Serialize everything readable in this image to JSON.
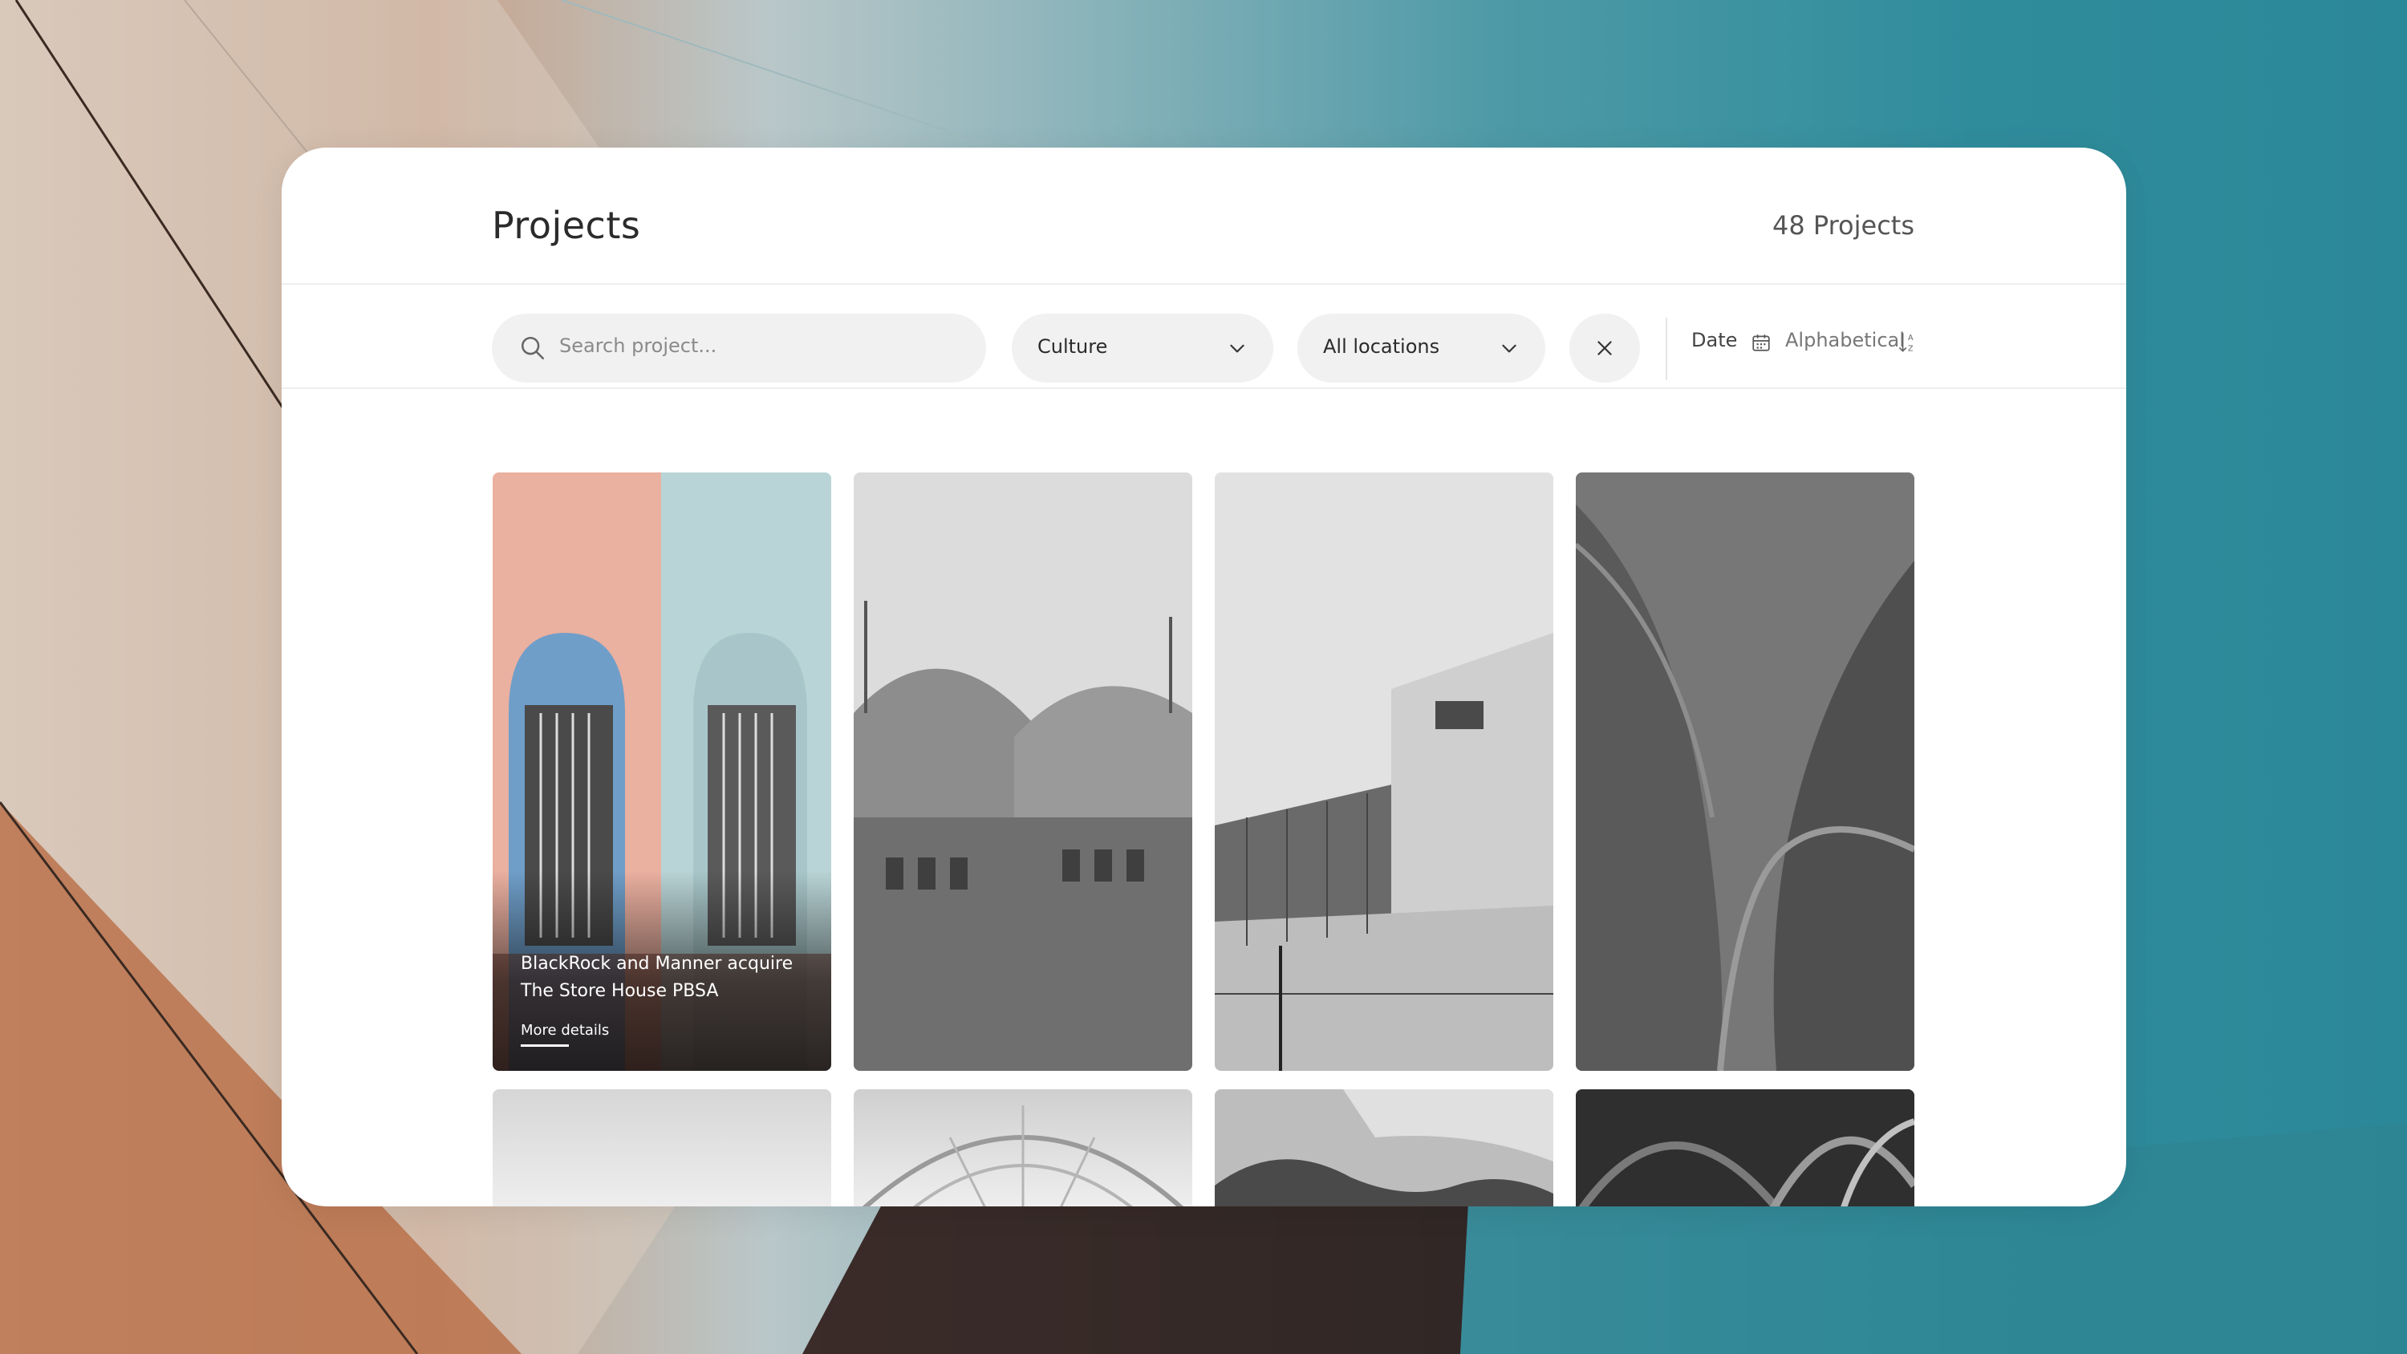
{
  "header": {
    "title": "Projects",
    "count": "48 Projects"
  },
  "filters": {
    "search_placeholder": "Search project...",
    "category": "Culture",
    "location": "All locations",
    "sort_date_label": "Date",
    "sort_alpha_label": "Alphabetical"
  },
  "projects": [
    {
      "title": "BlackRock and Manner acquire The Store House PBSA",
      "link": "More details"
    }
  ],
  "icons": {
    "search": "search-icon",
    "chevron": "chevron-down-icon",
    "clear": "close-icon",
    "calendar": "calendar-icon",
    "sort": "sort-az-icon"
  },
  "colors": {
    "card_bg": "#ffffff",
    "control_bg": "#f1f1f1",
    "text_primary": "#2b2b2b",
    "text_secondary": "#777777"
  }
}
